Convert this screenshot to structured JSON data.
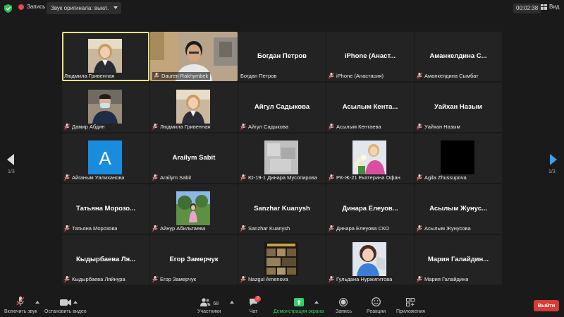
{
  "topbar": {
    "record_label": "Запись",
    "original_sound": "Звук оригинала: выкл.",
    "timer": "00:02:38",
    "view_label": "Вид"
  },
  "pagination": {
    "left": "1/3",
    "right": "1/3"
  },
  "tiles": [
    {
      "big": "",
      "label": "Людмила Гривенная",
      "muted": false,
      "pic": "woman"
    },
    {
      "big": "",
      "label": "Dauren Rakhymbek",
      "muted": true,
      "pic": "video"
    },
    {
      "big": "Богдан Петров",
      "label": "Богдан Петров",
      "muted": false
    },
    {
      "big": "iPhone (Анаст...",
      "label": "iPhone (Анастасия)",
      "muted": true
    },
    {
      "big": "Аманкелдина С...",
      "label": "Аманкелдина Сымбат",
      "muted": true
    },
    {
      "big": "",
      "label": "Дамир Абдин",
      "muted": true,
      "pic": "mask"
    },
    {
      "big": "",
      "label": "Людмила Гривенная",
      "muted": true,
      "pic": "woman"
    },
    {
      "big": "Айгул Садыкова",
      "label": "Айгул Садыкова",
      "muted": true
    },
    {
      "big": "Асылым Кента...",
      "label": "Асылым Кентаева",
      "muted": true
    },
    {
      "big": "Уайхан Назым",
      "label": "Уайхан Назым",
      "muted": true
    },
    {
      "big": "",
      "label": "Айганым Уалиханова",
      "muted": true,
      "pic": "letter",
      "letter": "A"
    },
    {
      "big": "Arailym Sabit",
      "label": "Arailym Sabit",
      "muted": true
    },
    {
      "big": "",
      "label": "Ю-19-1 Динара Мусопирова",
      "muted": true,
      "pic": "blur"
    },
    {
      "big": "",
      "label": "РК-Ж-21 Екатерина Офан",
      "muted": true,
      "pic": "flowers"
    },
    {
      "big": "",
      "label": "Agila Zhussupova",
      "muted": true,
      "pic": "black"
    },
    {
      "big": "Татьяна Морозо...",
      "label": "Татьяна Морозова",
      "muted": true
    },
    {
      "big": "",
      "label": "Айнур Абильтаева",
      "muted": true,
      "pic": "outdoor"
    },
    {
      "big": "Sanzhar Kuanysh",
      "label": "Sanzhar Kuanysh",
      "muted": true
    },
    {
      "big": "Динара Елеуов...",
      "label": "Динара Елеуова СКО",
      "muted": true
    },
    {
      "big": "Асылым Жунус...",
      "label": "Асылым Жунусова",
      "muted": true
    },
    {
      "big": "Кыдырбаева Ля...",
      "label": "Кыдырбаева Ляйнура",
      "muted": true
    },
    {
      "big": "Егор Замерчук",
      "label": "Егор Замерчук",
      "muted": true
    },
    {
      "big": "",
      "label": "Nazgul Amenova",
      "muted": true,
      "pic": "collage"
    },
    {
      "big": "",
      "label": "Гульдана Нуржигитова",
      "muted": true,
      "pic": "selfie"
    },
    {
      "big": "Мария Галайдин...",
      "label": "Мария Галайдина",
      "muted": true
    }
  ],
  "toolbar": {
    "unmute": "Включить звук",
    "start_video": "Остановить видео",
    "participants": "Участники",
    "participants_count": "68",
    "chat": "Чат",
    "chat_badge": "2",
    "share": "Демонстрация экрана",
    "record": "Запись",
    "reactions": "Реакции",
    "apps": "Приложения",
    "leave": "Выйти"
  },
  "colors": {
    "accent_green": "#2fd26b",
    "active_speaker": "#e6e684",
    "leave_red": "#d93a34",
    "arrow_blue": "#3aa0f0"
  }
}
